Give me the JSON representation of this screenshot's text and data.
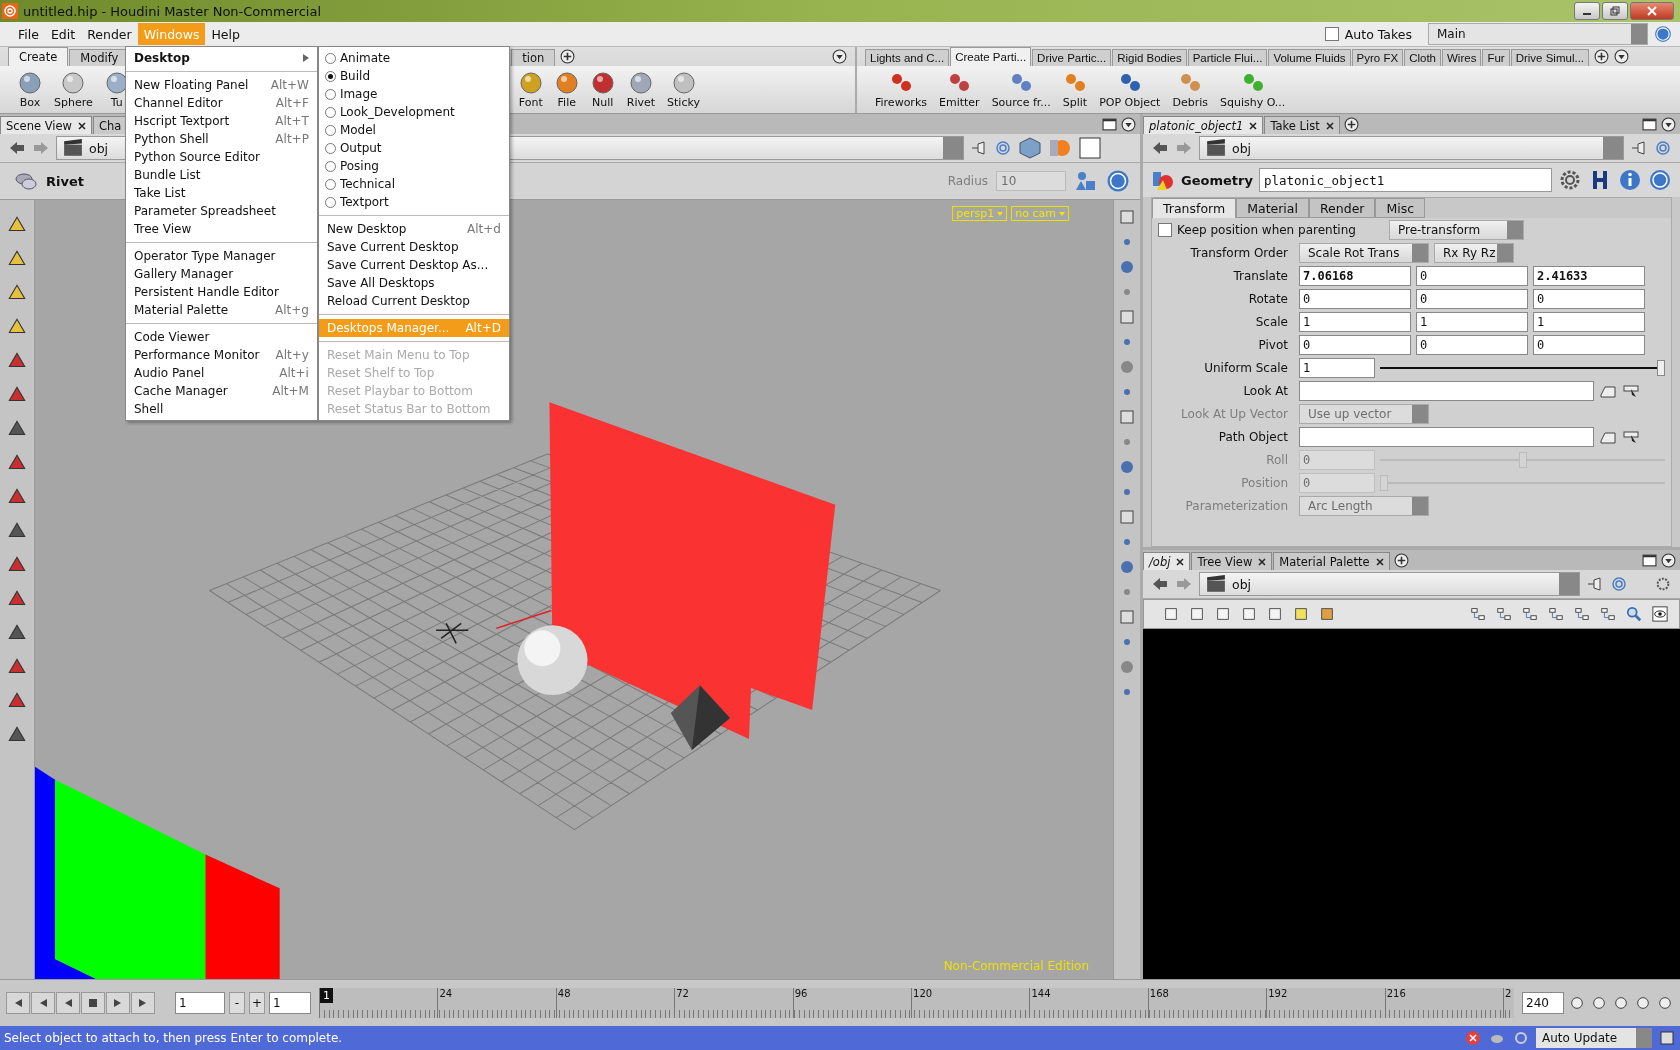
{
  "window": {
    "title": "untitled.hip - Houdini Master Non-Commercial"
  },
  "menu_bar": [
    {
      "label": "File",
      "selected": false
    },
    {
      "label": "Edit",
      "selected": false
    },
    {
      "label": "Render",
      "selected": false
    },
    {
      "label": "Windows",
      "selected": true
    },
    {
      "label": "Help",
      "selected": false
    }
  ],
  "auto_takes": {
    "label": "Auto Takes",
    "checked": false
  },
  "take_select": {
    "value": "Main"
  },
  "shelf_left": {
    "tabs": [
      [
        {
          "label": "Create",
          "selected": true
        },
        {
          "label": "Modify",
          "selected": false
        }
      ],
      [
        {
          "label": "tion",
          "selected": false
        }
      ]
    ],
    "tools": [
      [
        {
          "label": "Box"
        },
        {
          "label": "Sphere"
        },
        {
          "label": "Tu"
        }
      ],
      [
        {
          "label": "Font"
        },
        {
          "label": "File"
        },
        {
          "label": "Null"
        },
        {
          "label": "Rivet"
        },
        {
          "label": "Sticky"
        }
      ]
    ]
  },
  "shelf_right": {
    "tabs": [
      {
        "label": "Lights and C...",
        "selected": false
      },
      {
        "label": "Create Parti...",
        "selected": true
      },
      {
        "label": "Drive Partic...",
        "selected": false
      },
      {
        "label": "Rigid Bodies",
        "selected": false
      },
      {
        "label": "Particle Flui...",
        "selected": false
      },
      {
        "label": "Volume Fluids",
        "selected": false
      },
      {
        "label": "Pyro FX",
        "selected": false
      },
      {
        "label": "Cloth",
        "selected": false
      },
      {
        "label": "Wires",
        "selected": false
      },
      {
        "label": "Fur",
        "selected": false
      },
      {
        "label": "Drive Simul...",
        "selected": false
      }
    ],
    "tools": [
      {
        "label": "Fireworks"
      },
      {
        "label": "Emitter"
      },
      {
        "label": "Source fr..."
      },
      {
        "label": "Split"
      },
      {
        "label": "POP Object"
      },
      {
        "label": "Debris"
      },
      {
        "label": "Squishy O..."
      }
    ]
  },
  "scene_pane": {
    "tabs": [
      {
        "label": "Scene View",
        "selected": true
      },
      {
        "label": "Cha",
        "selected": false
      }
    ],
    "path": "obj",
    "tool_name": "Rivet",
    "radius": {
      "label": "Radius",
      "value": "10"
    },
    "viewport": {
      "camera": "persp1",
      "cam": "no cam",
      "edition": "Non-Commercial Edition"
    }
  },
  "param_pane": {
    "tabs": [
      {
        "label": "platonic_object1",
        "selected": true
      },
      {
        "label": "Take List",
        "selected": false
      }
    ],
    "path": "obj",
    "node_type": "Geometry",
    "node_name": "platonic_object1",
    "param_tabs": [
      {
        "label": "Transform",
        "selected": true
      },
      {
        "label": "Material",
        "selected": false
      },
      {
        "label": "Render",
        "selected": false
      },
      {
        "label": "Misc",
        "selected": false
      }
    ],
    "keep_position": {
      "label": "Keep position when parenting",
      "checked": false,
      "menu": "Pre-transform"
    },
    "params": [
      {
        "label": "Transform Order",
        "kind": "menus",
        "disabled": false,
        "menus": [
          "Scale Rot Trans",
          "Rx Ry Rz"
        ]
      },
      {
        "label": "Translate",
        "kind": "vector",
        "disabled": false,
        "values": [
          {
            "value": "7.06168",
            "modified": true
          },
          {
            "value": "0",
            "modified": false
          },
          {
            "value": "2.41633",
            "modified": true
          }
        ]
      },
      {
        "label": "Rotate",
        "kind": "vector",
        "disabled": false,
        "values": [
          {
            "value": "0",
            "modified": false
          },
          {
            "value": "0",
            "modified": false
          },
          {
            "value": "0",
            "modified": false
          }
        ]
      },
      {
        "label": "Scale",
        "kind": "vector",
        "disabled": false,
        "values": [
          {
            "value": "1",
            "modified": false
          },
          {
            "value": "1",
            "modified": false
          },
          {
            "value": "1",
            "modified": false
          }
        ]
      },
      {
        "label": "Pivot",
        "kind": "vector",
        "disabled": false,
        "values": [
          {
            "value": "0",
            "modified": false
          },
          {
            "value": "0",
            "modified": false
          },
          {
            "value": "0",
            "modified": false
          }
        ]
      },
      {
        "label": "Uniform Scale",
        "kind": "slider",
        "disabled": false,
        "value": "1",
        "level": 1
      },
      {
        "label": "Look At",
        "kind": "path",
        "disabled": false
      },
      {
        "label": "Look At Up Vector",
        "kind": "menu",
        "disabled": true,
        "value": "Use up vector"
      },
      {
        "label": "Path Object",
        "kind": "path",
        "disabled": false
      },
      {
        "label": "Roll",
        "kind": "slider",
        "disabled": true,
        "value": "0",
        "level": 0.5
      },
      {
        "label": "Position",
        "kind": "slider",
        "disabled": true,
        "value": "0",
        "level": 0
      },
      {
        "label": "Parameterization",
        "kind": "menu",
        "disabled": true,
        "value": "Arc Length"
      }
    ]
  },
  "network_pane": {
    "tabs": [
      {
        "label": "/obj",
        "selected": true
      },
      {
        "label": "Tree View",
        "selected": false
      },
      {
        "label": "Material Palette",
        "selected": false
      }
    ],
    "path": "obj"
  },
  "timeline": {
    "frame": "1",
    "step": "1",
    "minus": "-",
    "plus": "+",
    "current": "1",
    "labels": [
      "24",
      "48",
      "72",
      "96",
      "120",
      "144",
      "168",
      "192",
      "216",
      "2"
    ],
    "end": "240"
  },
  "status_bar": {
    "message": "Select object to attach to, then press Enter to complete.",
    "update_mode": "Auto Update"
  },
  "windows_menu": {
    "groups": [
      [
        {
          "label": "Desktop",
          "kind": "submenu"
        }
      ],
      [
        {
          "label": "New Floating Panel",
          "kind": "item",
          "shortcut": "Alt+W"
        },
        {
          "label": "Channel Editor",
          "kind": "item",
          "shortcut": "Alt+F"
        },
        {
          "label": "Hscript Textport",
          "kind": "item",
          "shortcut": "Alt+T"
        },
        {
          "label": "Python Shell",
          "kind": "item",
          "shortcut": "Alt+P"
        },
        {
          "label": "Python Source Editor",
          "kind": "item"
        },
        {
          "label": "Bundle List",
          "kind": "item"
        },
        {
          "label": "Take List",
          "kind": "item"
        },
        {
          "label": "Parameter Spreadsheet",
          "kind": "item"
        },
        {
          "label": "Tree View",
          "kind": "item"
        }
      ],
      [
        {
          "label": "Operator Type Manager",
          "kind": "item"
        },
        {
          "label": "Gallery Manager",
          "kind": "item"
        },
        {
          "label": "Persistent Handle Editor",
          "kind": "item"
        },
        {
          "label": "Material Palette",
          "kind": "item",
          "shortcut": "Alt+g"
        }
      ],
      [
        {
          "label": "Code Viewer",
          "kind": "item"
        },
        {
          "label": "Performance Monitor",
          "kind": "item",
          "shortcut": "Alt+y"
        },
        {
          "label": "Audio Panel",
          "kind": "item",
          "shortcut": "Alt+i"
        },
        {
          "label": "Cache Manager",
          "kind": "item",
          "shortcut": "Alt+M"
        },
        {
          "label": "Shell",
          "kind": "item"
        }
      ]
    ]
  },
  "desktop_menu": {
    "groups": [
      [
        {
          "label": "Animate",
          "kind": "radio",
          "selected": false
        },
        {
          "label": "Build",
          "kind": "radio",
          "selected": true
        },
        {
          "label": "Image",
          "kind": "radio",
          "selected": false
        },
        {
          "label": "Look_Development",
          "kind": "radio",
          "selected": false
        },
        {
          "label": "Model",
          "kind": "radio",
          "selected": false
        },
        {
          "label": "Output",
          "kind": "radio",
          "selected": false
        },
        {
          "label": "Posing",
          "kind": "radio",
          "selected": false
        },
        {
          "label": "Technical",
          "kind": "radio",
          "selected": false
        },
        {
          "label": "Textport",
          "kind": "radio",
          "selected": false
        }
      ],
      [
        {
          "label": "New Desktop",
          "kind": "item",
          "shortcut": "Alt+d",
          "highlighted": false,
          "disabled": false
        },
        {
          "label": "Save Current Desktop",
          "kind": "item",
          "highlighted": false,
          "disabled": false
        },
        {
          "label": "Save Current Desktop As...",
          "kind": "item",
          "highlighted": false,
          "disabled": false
        },
        {
          "label": "Save All Desktops",
          "kind": "item",
          "highlighted": false,
          "disabled": false
        },
        {
          "label": "Reload Current Desktop",
          "kind": "item",
          "highlighted": false,
          "disabled": false
        }
      ],
      [
        {
          "label": "Desktops Manager...",
          "kind": "item",
          "shortcut": "Alt+D",
          "highlighted": true,
          "disabled": false
        }
      ],
      [
        {
          "label": "Reset Main Menu to Top",
          "kind": "item",
          "highlighted": false,
          "disabled": true
        },
        {
          "label": "Reset Shelf to Top",
          "kind": "item",
          "highlighted": false,
          "disabled": true
        },
        {
          "label": "Reset Playbar to Bottom",
          "kind": "item",
          "highlighted": false,
          "disabled": true
        },
        {
          "label": "Reset Status Bar to Bottom",
          "kind": "item",
          "highlighted": false,
          "disabled": true
        }
      ]
    ]
  }
}
